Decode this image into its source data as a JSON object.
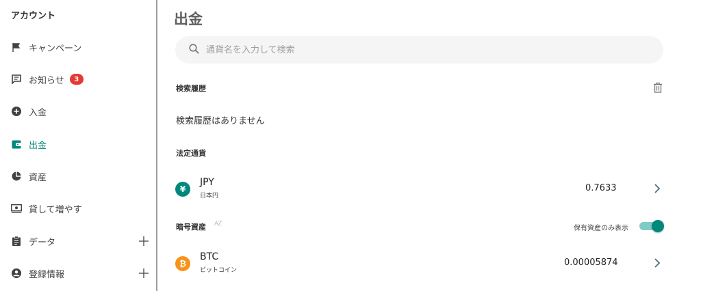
{
  "sidebar": {
    "title": "アカウント",
    "items": [
      {
        "label": "キャンペーン"
      },
      {
        "label": "お知らせ",
        "badge": "3"
      },
      {
        "label": "入金"
      },
      {
        "label": "出金",
        "active": true
      },
      {
        "label": "資産"
      },
      {
        "label": "貸して増やす"
      },
      {
        "label": "データ",
        "expandable": true
      },
      {
        "label": "登録情報",
        "expandable": true
      }
    ]
  },
  "main": {
    "title": "出金",
    "search": {
      "placeholder": "通貨名を入力して検索",
      "value": ""
    },
    "history": {
      "heading": "検索履歴",
      "empty_message": "検索履歴はありません"
    },
    "fiat": {
      "heading": "法定通貨",
      "items": [
        {
          "symbol": "¥",
          "code": "JPY",
          "name": "日本円",
          "value": "0.7633"
        }
      ]
    },
    "crypto": {
      "heading": "暗号資産",
      "sort_icon": "AZ",
      "toggle_label": "保有資産のみ表示",
      "toggle_on": true,
      "items": [
        {
          "symbol": "₿",
          "code": "BTC",
          "name": "ビットコイン",
          "value": "0.00005874"
        }
      ]
    }
  },
  "colors": {
    "accent": "#00897b",
    "badge": "#e53935",
    "jpy": "#00897b",
    "btc": "#f7931a"
  }
}
